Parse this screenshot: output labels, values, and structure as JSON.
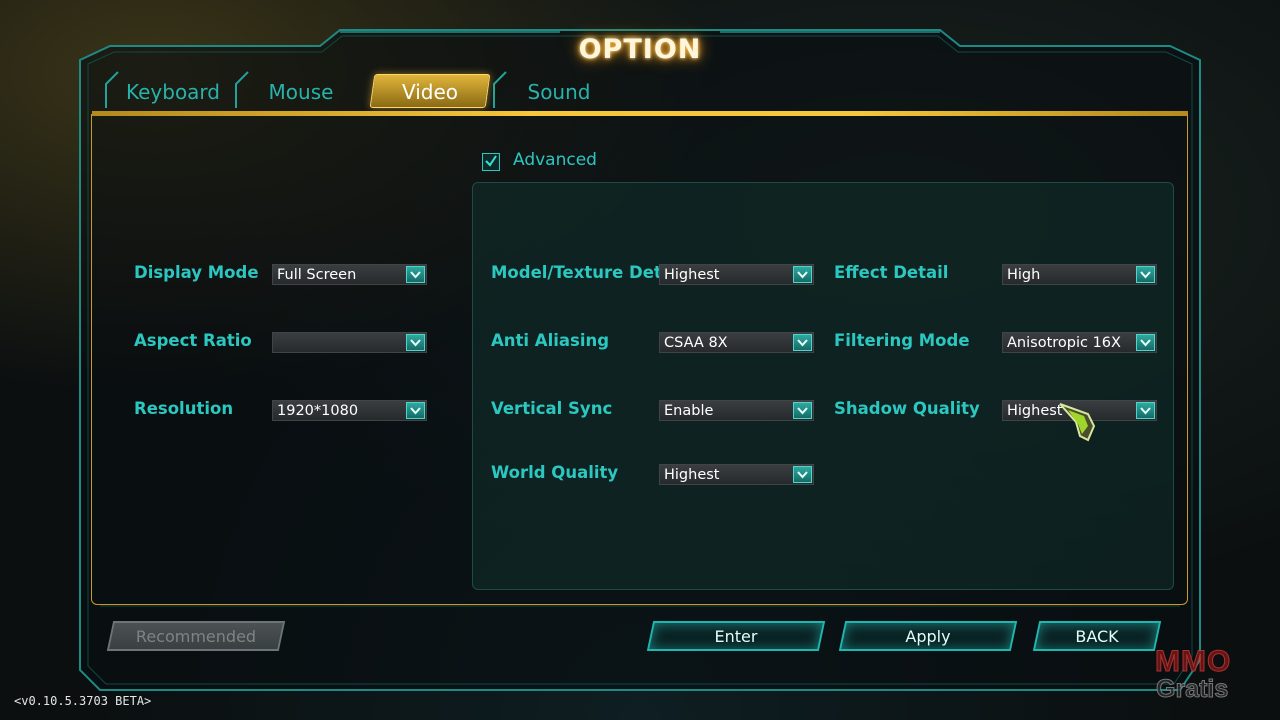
{
  "window": {
    "title": "OPTION"
  },
  "tabs": [
    {
      "label": "Keyboard",
      "active": false
    },
    {
      "label": "Mouse",
      "active": false
    },
    {
      "label": "Video",
      "active": true
    },
    {
      "label": "Sound",
      "active": false
    }
  ],
  "advanced": {
    "label": "Advanced",
    "checked": true
  },
  "basic_settings": [
    {
      "label": "Display Mode",
      "value": "Full Screen"
    },
    {
      "label": "Aspect Ratio",
      "value": ""
    },
    {
      "label": "Resolution",
      "value": "1920*1080"
    }
  ],
  "advanced_settings": {
    "left": [
      {
        "label": "Model/Texture Detail",
        "value": "Highest"
      },
      {
        "label": "Anti Aliasing",
        "value": "CSAA 8X"
      },
      {
        "label": "Vertical Sync",
        "value": "Enable"
      },
      {
        "label": "World Quality",
        "value": "Highest"
      }
    ],
    "right": [
      {
        "label": "Effect Detail",
        "value": "High"
      },
      {
        "label": "Filtering Mode",
        "value": "Anisotropic 16X"
      },
      {
        "label": "Shadow Quality",
        "value": "Highest"
      }
    ]
  },
  "buttons": {
    "recommended": "Recommended",
    "enter": "Enter",
    "apply": "Apply",
    "back": "BACK"
  },
  "version": "<v0.10.5.3703 BETA>",
  "watermark": {
    "line1": "MMO",
    "line2": "Gratis"
  },
  "colors": {
    "accent_teal": "#2bc7c0",
    "accent_gold": "#f6c63b",
    "dropdown_bg": "#2e3234"
  },
  "icons": [
    "checkmark-icon",
    "chevron-down-icon",
    "pointer-cursor-icon"
  ]
}
